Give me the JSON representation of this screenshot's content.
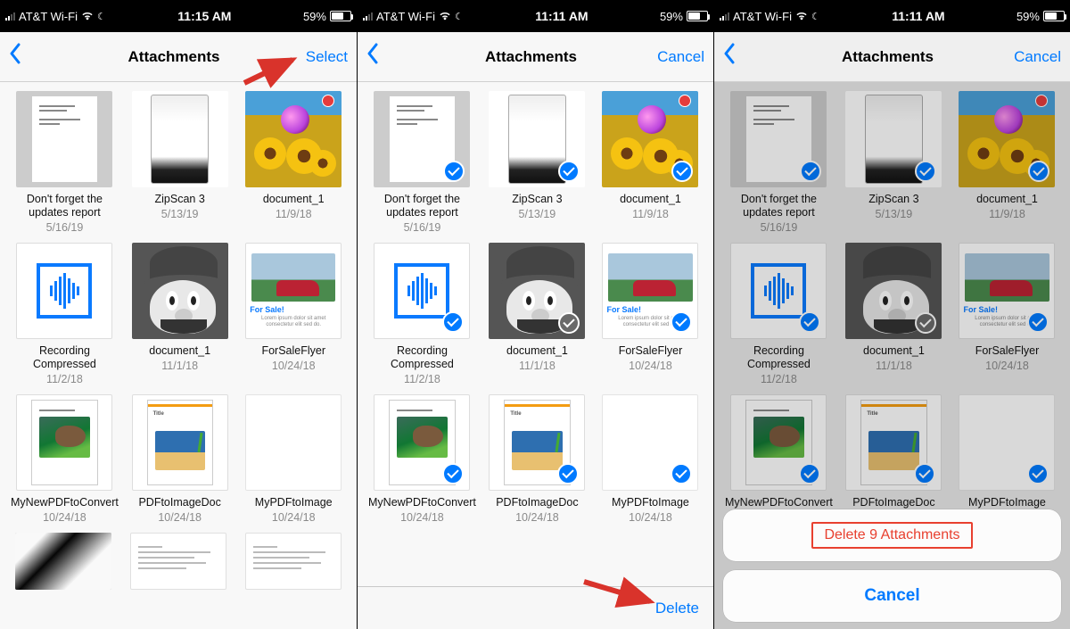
{
  "status": {
    "carrier": "AT&T Wi-Fi",
    "time1": "11:15 AM",
    "time2": "11:11 AM",
    "time3": "11:11 AM",
    "battery": "59%",
    "battery_fill_pct": 59
  },
  "nav": {
    "title": "Attachments",
    "select_label": "Select",
    "cancel_label": "Cancel"
  },
  "toolbar": {
    "delete_label": "Delete"
  },
  "sheet": {
    "delete_label": "Delete 9 Attachments",
    "cancel_label": "Cancel"
  },
  "items": [
    {
      "name": "Don't forget the updates report",
      "date": "5/16/19",
      "thumb": "doc-text"
    },
    {
      "name": "ZipScan 3",
      "date": "5/13/19",
      "thumb": "zipscan"
    },
    {
      "name": "document_1",
      "date": "11/9/18",
      "thumb": "sunflowers"
    },
    {
      "name": "Recording Compressed",
      "date": "11/2/18",
      "thumb": "audio"
    },
    {
      "name": "document_1",
      "date": "11/1/18",
      "thumb": "mario"
    },
    {
      "name": "ForSaleFlyer",
      "date": "10/24/18",
      "thumb": "forsale"
    },
    {
      "name": "MyNewPDFtoConvert",
      "date": "10/24/18",
      "thumb": "otter"
    },
    {
      "name": "PDFtoImageDoc",
      "date": "10/24/18",
      "thumb": "beach"
    },
    {
      "name": "MyPDFtoImage",
      "date": "10/24/18",
      "thumb": "blank"
    }
  ],
  "extra_row": [
    {
      "thumb": "bw"
    },
    {
      "thumb": "invoice"
    },
    {
      "thumb": "invoice"
    }
  ],
  "selection": {
    "screen2": [
      true,
      true,
      true,
      true,
      true,
      true,
      true,
      true,
      true
    ],
    "screen3": [
      true,
      true,
      true,
      true,
      true,
      true,
      true,
      true,
      true
    ]
  },
  "colors": {
    "accent": "#007aff",
    "destructive": "#e8402f"
  }
}
